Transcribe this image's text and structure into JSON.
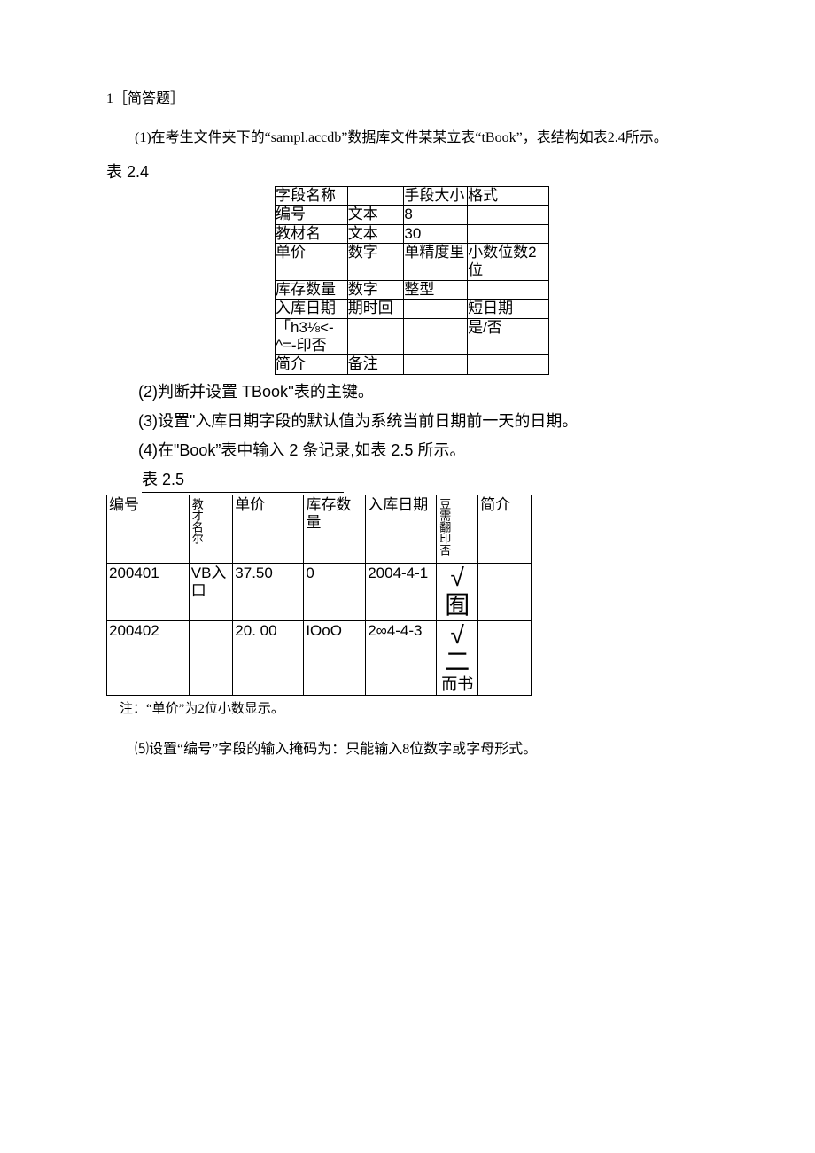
{
  "q_header": "1［简答题］",
  "p1": "(1)在考生文件夹下的“sampl.accdb”数据库文件某某立表“tBook”，表结构如表2.4所示。",
  "tbl24_label": "表 2.4",
  "tbl24": {
    "head": [
      "字段名称",
      "",
      "手段大小",
      "格式"
    ],
    "rows": [
      [
        "编号",
        "文本",
        "8",
        ""
      ],
      [
        "教材名",
        "文本",
        "30",
        ""
      ],
      [
        "单价",
        "数字",
        "单精度里",
        "小数位数2位"
      ],
      [
        "库存数量",
        "数字",
        "整型",
        ""
      ],
      [
        "入库日期",
        "期时回",
        "",
        "短日期"
      ],
      [
        "「h3⅛<-^=-印否",
        "",
        "",
        "是/否"
      ],
      [
        "简介",
        "备注",
        "",
        ""
      ]
    ]
  },
  "p2": "(2)判断并设置 TBook''表的主键。",
  "p3": "(3)设置\"入库日期字段的默认值为系统当前日期前一天的日期。",
  "p4": "(4)在\"Book”表中输入 2 条记录,如表 2.5 所示。",
  "tbl25_label": "表 2.5",
  "tbl25": {
    "head": [
      "编号",
      "教才名尔",
      "单价",
      "库存数量",
      "入库日期",
      "豆需翻印否",
      "简介"
    ],
    "rows": [
      [
        "200401",
        "VB入口",
        "37.50",
        "0",
        "2004-4-1",
        "√",
        "囿"
      ],
      [
        "200402",
        "",
        "20. 00",
        "IOoO",
        "2∞4-4-3",
        "√二",
        "而书"
      ]
    ]
  },
  "note": "注：“单价”为2位小数显示。",
  "p5": "⑸设置“编号”字段的输入掩码为：只能输入8位数字或字母形式。"
}
